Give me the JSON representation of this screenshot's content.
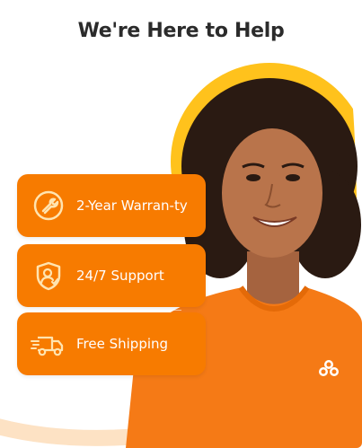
{
  "heading": "We're Here to Help",
  "features": [
    {
      "label": "2-Year Warran-ty",
      "icon": "wrench-icon"
    },
    {
      "label": "24/7 Support",
      "icon": "support-shield-icon"
    },
    {
      "label": "Free Shipping",
      "icon": "truck-icon"
    }
  ],
  "colors": {
    "accent": "#f77b00",
    "accent_light": "#ffc21c",
    "heading": "#2b2b2b"
  }
}
